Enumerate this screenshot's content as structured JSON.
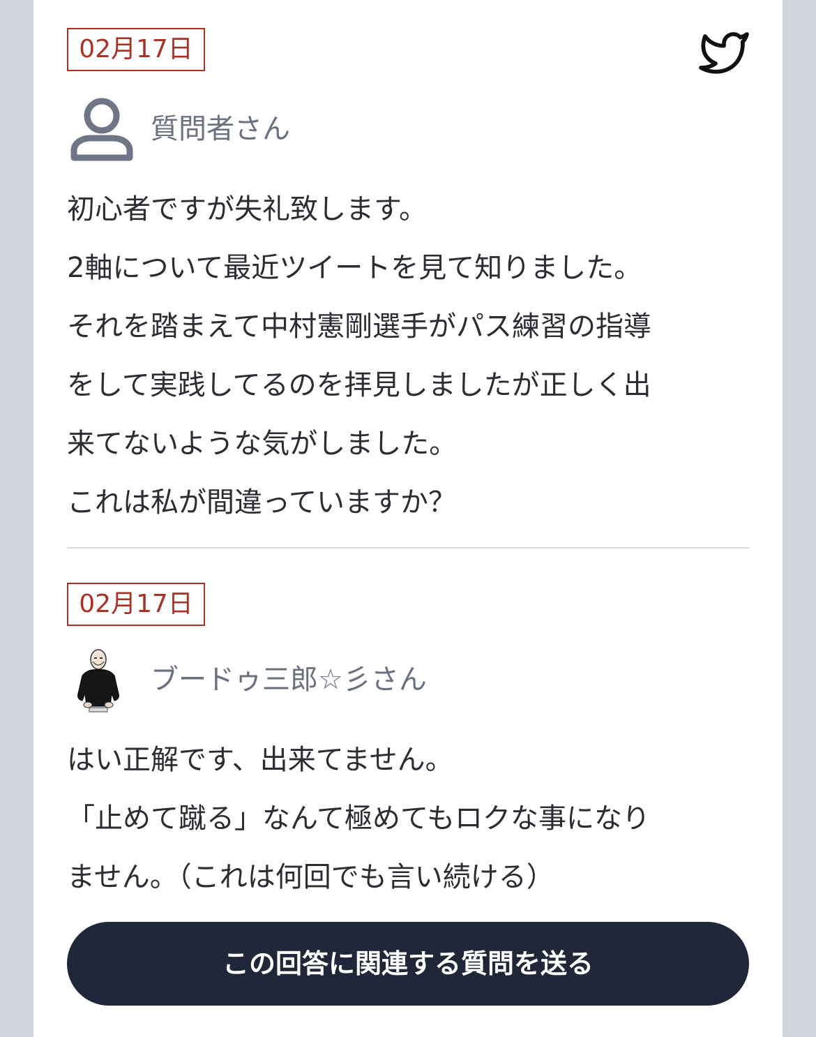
{
  "question": {
    "date": "02月17日",
    "author": "質問者さん",
    "lines": [
      "初心者ですが失礼致します。",
      "2軸について最近ツイートを見て知りました。",
      "それを踏まえて中村憲剛選手がパス練習の指導",
      "をして実践してるのを拝見しましたが正しく出",
      "来てないような気がしました。",
      "これは私が間違っていますか？"
    ]
  },
  "answer": {
    "date": "02月17日",
    "author": "ブードゥ三郎☆彡さん",
    "lines": [
      "はい正解です、出来てません。",
      "「止めて蹴る」なんて極めてもロクな事になり",
      "ません。（これは何回でも言い続ける）"
    ]
  },
  "cta_label": "この回答に関連する質問を送る",
  "icons": {
    "share": "twitter-icon",
    "asker": "person-icon",
    "answerer": "avatar"
  },
  "colors": {
    "date_accent": "#a93226",
    "button_bg": "#1f2738",
    "name_gray": "#6b7080",
    "text": "#2b2d33"
  }
}
